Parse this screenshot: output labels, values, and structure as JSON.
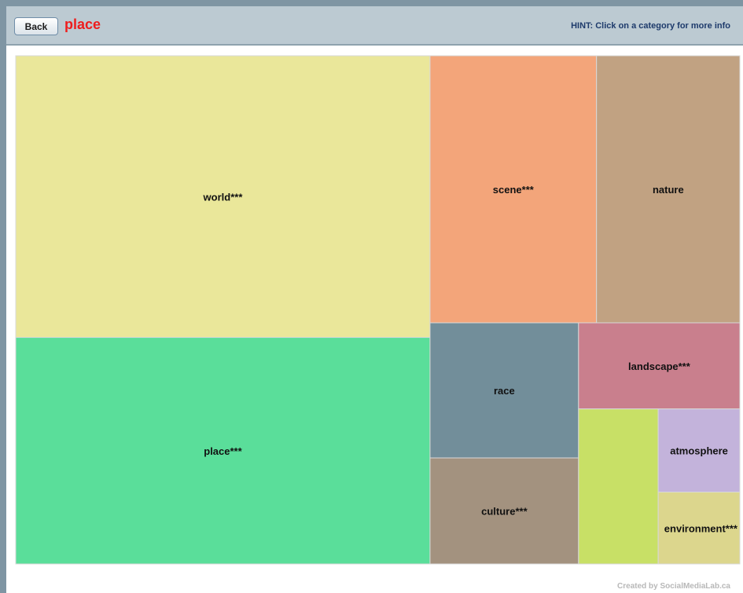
{
  "header": {
    "back_label": "Back",
    "title": "place",
    "hint": "HINT: Click on a category for more info"
  },
  "footer": {
    "credit": "Created by SocialMediaLab.ca"
  },
  "colors": {
    "title": "#ee1d1d",
    "hint": "#1d3a6b",
    "header_bg": "#bccad2",
    "tile_border": "#d8d8d8"
  },
  "chart_data": {
    "type": "treemap",
    "title": "place",
    "tiles": [
      {
        "label": "world***",
        "value": 189000,
        "color": "#eae79a"
      },
      {
        "label": "place***",
        "value": 152000,
        "color": "#5ade9a"
      },
      {
        "label": "scene***",
        "value": 72000,
        "color": "#f3a57a"
      },
      {
        "label": "nature",
        "value": 62000,
        "color": "#c1a282"
      },
      {
        "label": "race",
        "value": 32500,
        "color": "#728e9a"
      },
      {
        "label": "culture***",
        "value": 25500,
        "color": "#a3927f"
      },
      {
        "label": "landscape***",
        "value": 22500,
        "color": "#c97f8d"
      },
      {
        "label": "",
        "value": 20000,
        "color": "#c8e066"
      },
      {
        "label": "atmosphere",
        "value": 11000,
        "color": "#c3b3db"
      },
      {
        "label": "environment***",
        "value": 9500,
        "color": "#dcd68d"
      }
    ]
  }
}
